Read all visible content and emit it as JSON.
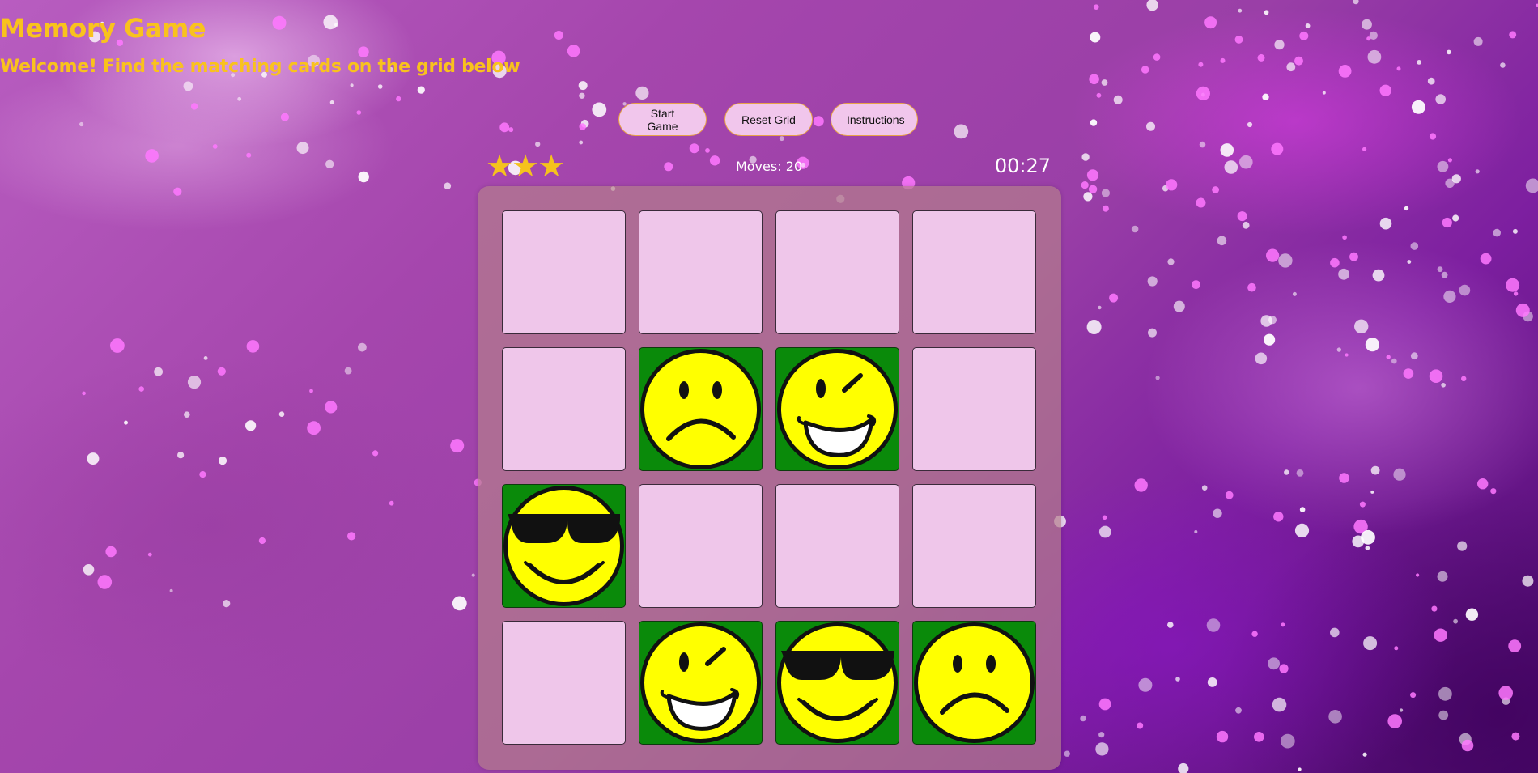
{
  "header": {
    "title": "Memory Game",
    "subtitle": "Welcome! Find the matching cards on the grid below"
  },
  "controls": {
    "start_label": "Start Game",
    "reset_label": "Reset Grid",
    "instructions_label": "Instructions"
  },
  "score": {
    "stars": 3,
    "moves_label": "Moves:",
    "moves_value": "20",
    "timer": "00:27"
  },
  "colors": {
    "title": "#f9c21d",
    "card_back": "#efc6ea",
    "card_open": "#0a8a0a",
    "smiley": "#ffff00"
  },
  "deck": {
    "rows": 4,
    "columns": 4,
    "cards": [
      {
        "state": "hidden",
        "face": ""
      },
      {
        "state": "hidden",
        "face": ""
      },
      {
        "state": "hidden",
        "face": ""
      },
      {
        "state": "hidden",
        "face": ""
      },
      {
        "state": "hidden",
        "face": ""
      },
      {
        "state": "open",
        "face": "sad-face-icon"
      },
      {
        "state": "open",
        "face": "wink-face-icon"
      },
      {
        "state": "hidden",
        "face": ""
      },
      {
        "state": "open",
        "face": "sunglasses-face-icon"
      },
      {
        "state": "hidden",
        "face": ""
      },
      {
        "state": "hidden",
        "face": ""
      },
      {
        "state": "hidden",
        "face": ""
      },
      {
        "state": "hidden",
        "face": ""
      },
      {
        "state": "open",
        "face": "wink-face-icon"
      },
      {
        "state": "open",
        "face": "sunglasses-face-icon"
      },
      {
        "state": "open",
        "face": "sad-face-icon"
      }
    ]
  }
}
